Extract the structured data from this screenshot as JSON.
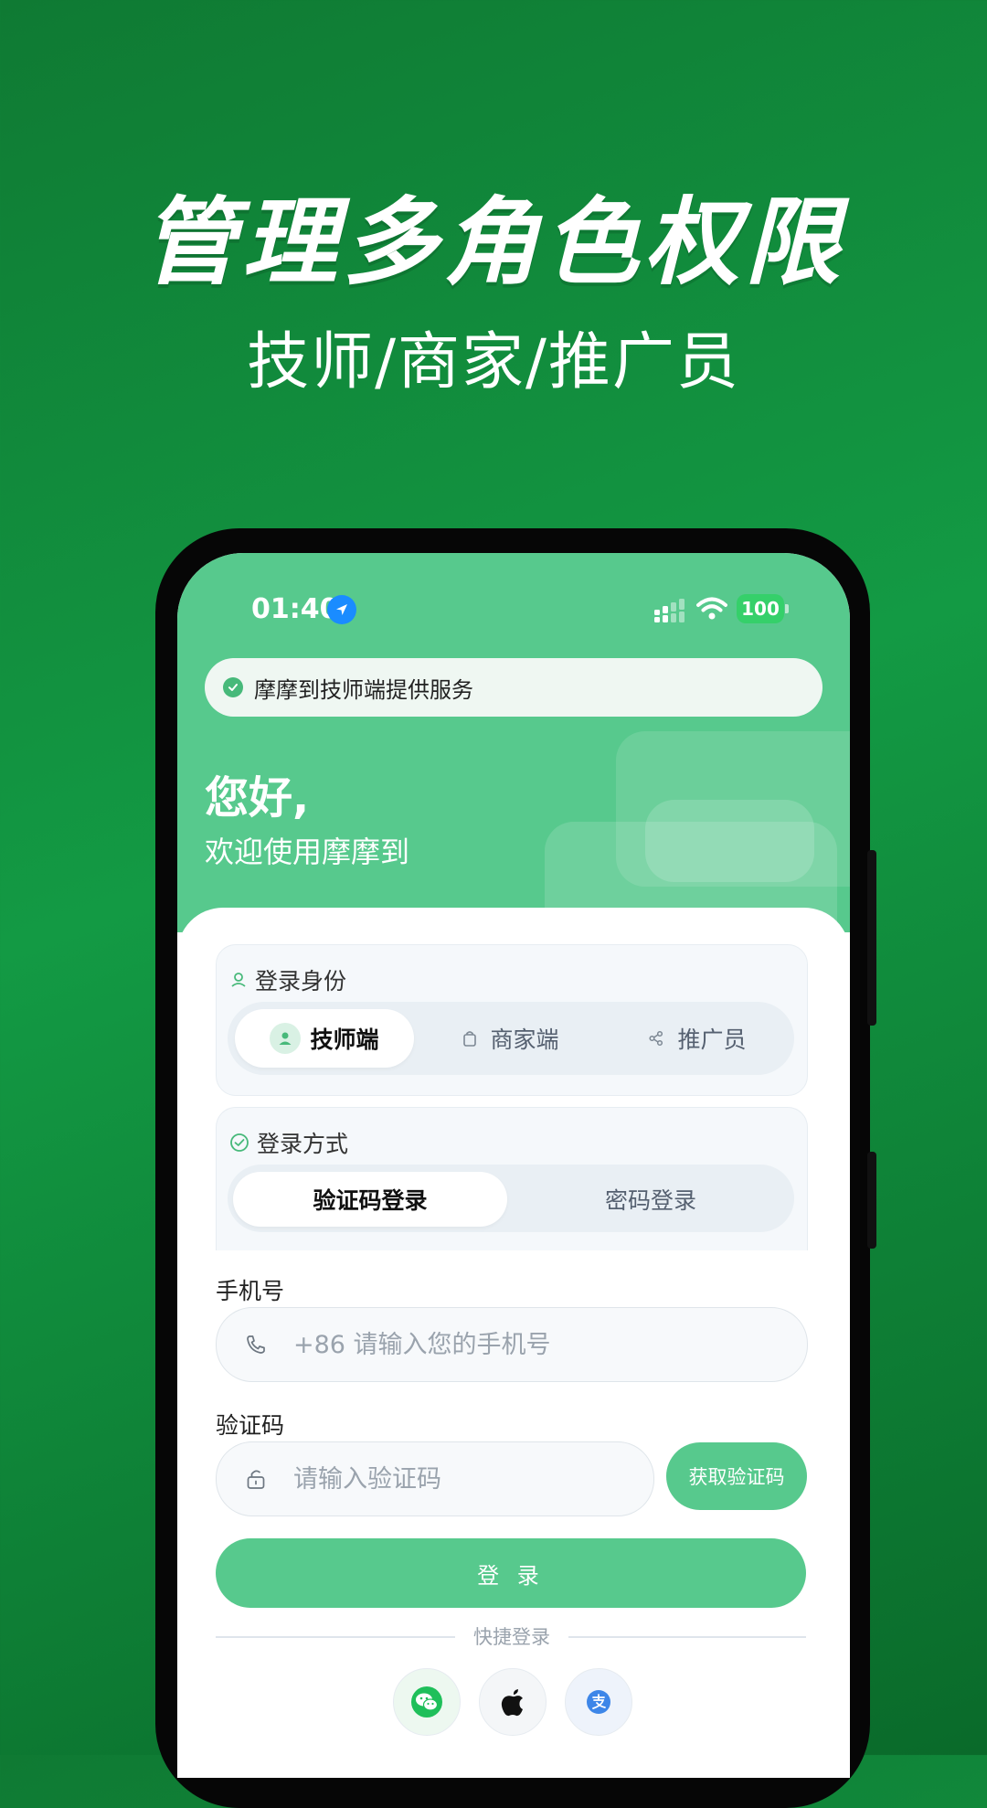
{
  "promo": {
    "headline": "管理多角色权限",
    "subheadline": "技师/商家/推广员"
  },
  "status_bar": {
    "time": "01:40",
    "battery": "100"
  },
  "notice": {
    "text": "摩摩到技师端提供服务"
  },
  "greeting": {
    "title": "您好,",
    "subtitle": "欢迎使用摩摩到"
  },
  "role_section": {
    "label": "登录身份",
    "options": [
      "技师端",
      "商家端",
      "推广员"
    ],
    "selected": "技师端"
  },
  "mode_section": {
    "label": "登录方式",
    "options": [
      "验证码登录",
      "密码登录"
    ],
    "selected": "验证码登录"
  },
  "phone_field": {
    "label": "手机号",
    "placeholder": "+86 请输入您的手机号",
    "value": ""
  },
  "code_field": {
    "label": "验证码",
    "placeholder": "请输入验证码",
    "value": "",
    "get_code_label": "获取验证码"
  },
  "login_button": {
    "label": "登 录"
  },
  "quick_login": {
    "label": "快捷登录",
    "providers": [
      "wechat-icon",
      "apple-icon",
      "alipay-icon"
    ]
  },
  "colors": {
    "background": "#139a44",
    "accent": "#57c98d",
    "text_dark": "#111111"
  }
}
